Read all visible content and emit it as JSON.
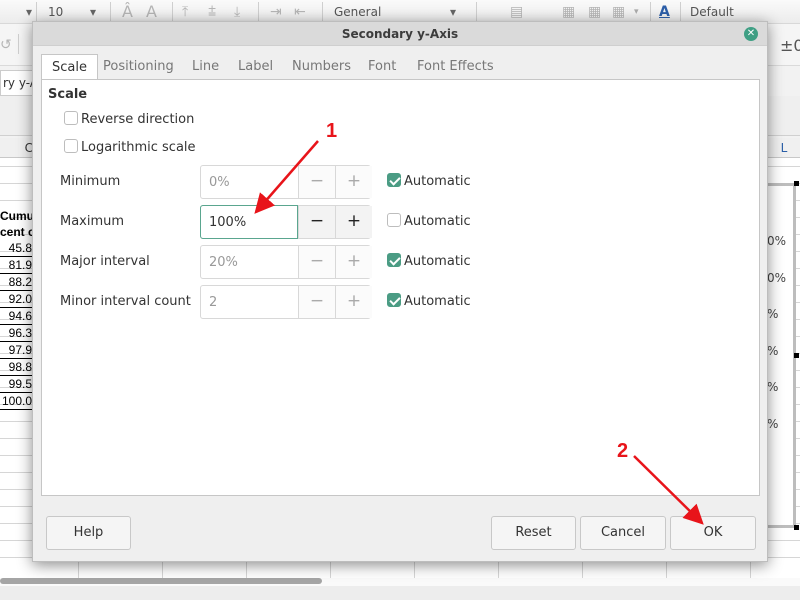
{
  "toolbar": {
    "font_size": "10",
    "number_format": "General",
    "style_name": "Default",
    "delta_label": "±0"
  },
  "namebox": {
    "value": "ry y-Axis"
  },
  "column_headers": {
    "left": "C",
    "right": "L"
  },
  "sheet": {
    "header_line1": "Cumul",
    "header_line2": "cent c",
    "values": [
      "45.8",
      "81.9",
      "88.2",
      "92.0",
      "94.6",
      "96.3",
      "97.9",
      "98.8",
      "99.5",
      "100.0"
    ],
    "chart_labels": [
      "0%",
      "0%",
      "%",
      "%",
      "%",
      "%"
    ]
  },
  "dialog": {
    "title": "Secondary y-Axis",
    "tabs": [
      {
        "label": "Scale",
        "active": true
      },
      {
        "label": "Positioning",
        "active": false
      },
      {
        "label": "Line",
        "active": false
      },
      {
        "label": "Label",
        "active": false
      },
      {
        "label": "Numbers",
        "active": false
      },
      {
        "label": "Font",
        "active": false
      },
      {
        "label": "Font Effects",
        "active": false
      }
    ],
    "scale": {
      "section_title": "Scale",
      "reverse_direction": {
        "label": "Reverse direction",
        "checked": false
      },
      "logarithmic_scale": {
        "label": "Logarithmic scale",
        "checked": false
      },
      "fields": [
        {
          "label": "Minimum",
          "value": "0%",
          "automatic": true,
          "auto_label": "Automatic"
        },
        {
          "label": "Maximum",
          "value": "100%",
          "automatic": false,
          "auto_label": "Automatic"
        },
        {
          "label": "Major interval",
          "value": "20%",
          "automatic": true,
          "auto_label": "Automatic"
        },
        {
          "label": "Minor interval count",
          "value": "2",
          "automatic": true,
          "auto_label": "Automatic"
        }
      ]
    },
    "buttons": {
      "help": "Help",
      "reset": "Reset",
      "cancel": "Cancel",
      "ok": "OK"
    }
  },
  "annotations": [
    {
      "label": "1",
      "color": "#e8141a"
    },
    {
      "label": "2",
      "color": "#e8141a"
    }
  ]
}
